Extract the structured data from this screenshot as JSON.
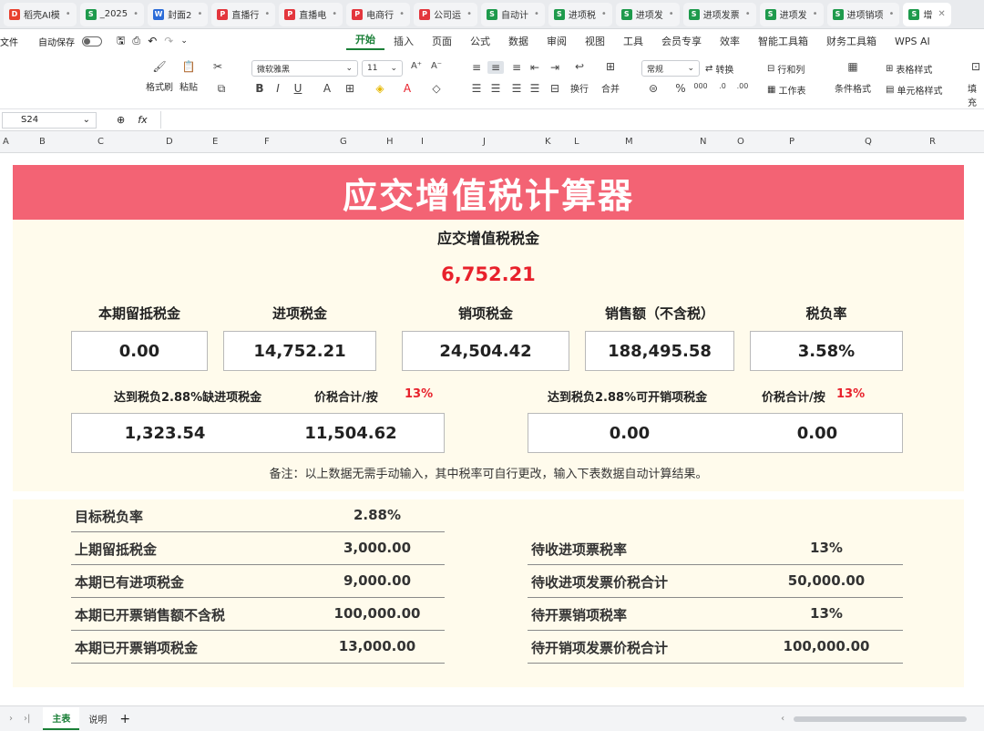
{
  "browser_tabs": [
    {
      "label": "稻壳AI模",
      "icon": "D",
      "color": "#e8412f"
    },
    {
      "label": "_2025",
      "icon": "S",
      "color": "#1e9a4c"
    },
    {
      "label": "封面2",
      "icon": "W",
      "color": "#2b6cd8"
    },
    {
      "label": "直播行",
      "icon": "P",
      "color": "#e3363d"
    },
    {
      "label": "直播电",
      "icon": "P",
      "color": "#e3363d"
    },
    {
      "label": "电商行",
      "icon": "P",
      "color": "#e3363d"
    },
    {
      "label": "公司运",
      "icon": "P",
      "color": "#e3363d"
    },
    {
      "label": "自动计",
      "icon": "S",
      "color": "#1e9a4c"
    },
    {
      "label": "进项税",
      "icon": "S",
      "color": "#1e9a4c"
    },
    {
      "label": "进项发",
      "icon": "S",
      "color": "#1e9a4c"
    },
    {
      "label": "进项发票",
      "icon": "S",
      "color": "#1e9a4c"
    },
    {
      "label": "进项发",
      "icon": "S",
      "color": "#1e9a4c"
    },
    {
      "label": "进项销项",
      "icon": "S",
      "color": "#1e9a4c"
    },
    {
      "label": "增",
      "icon": "S",
      "color": "#1e9a4c"
    }
  ],
  "menubar": {
    "file": "文件",
    "autosave": "自动保存",
    "items": [
      "开始",
      "插入",
      "页面",
      "公式",
      "数据",
      "审阅",
      "视图",
      "工具",
      "会员专享",
      "效率",
      "智能工具箱",
      "财务工具箱",
      "WPS AI"
    ]
  },
  "ribbon": {
    "format_painter": "格式刷",
    "paste": "粘贴",
    "font_name": "微软雅黑",
    "font_size": "11",
    "wrap": "换行",
    "merge": "合并",
    "number_format": "常规",
    "convert": "转换",
    "rows_cols": "行和列",
    "worksheet": "工作表",
    "cond_format": "条件格式",
    "table_style": "表格样式",
    "cell_style": "单元格样式",
    "fill": "填充"
  },
  "formula_bar": {
    "cell_ref": "S24",
    "fx": "fx"
  },
  "columns": [
    "A",
    "B",
    "C",
    "D",
    "E",
    "F",
    "G",
    "H",
    "I",
    "J",
    "K",
    "L",
    "M",
    "N",
    "O",
    "P",
    "Q",
    "R"
  ],
  "calculator": {
    "title": "应交增值税计算器",
    "payable_label": "应交增值税税金",
    "payable_value": "6,752.21",
    "metrics": [
      {
        "label": "本期留抵税金",
        "value": "0.00"
      },
      {
        "label": "进项税金",
        "value": "14,752.21"
      },
      {
        "label": "销项税金",
        "value": "24,504.42"
      },
      {
        "label": "销售额（不含税）",
        "value": "188,495.58"
      },
      {
        "label": "税负率",
        "value": "3.58%"
      }
    ],
    "left_block": {
      "label": "达到税负2.88%缺进项税金",
      "sub_label": "价税合计/按",
      "rate": "13%",
      "value1": "1,323.54",
      "value2": "11,504.62"
    },
    "right_block": {
      "label": "达到税负2.88%可开销项税金",
      "sub_label": "价税合计/按",
      "rate": "13%",
      "value1": "0.00",
      "value2": "0.00"
    },
    "note": "备注：以上数据无需手动输入，其中税率可自行更改，输入下表数据自动计算结果。"
  },
  "inputs": {
    "left": [
      {
        "label": "目标税负率",
        "value": "2.88%"
      },
      {
        "label": "上期留抵税金",
        "value": "3,000.00"
      },
      {
        "label": "本期已有进项税金",
        "value": "9,000.00"
      },
      {
        "label": "本期已开票销售额不含税",
        "value": "100,000.00"
      },
      {
        "label": "本期已开票销项税金",
        "value": "13,000.00"
      }
    ],
    "right": [
      {
        "label": "待收进项票税率",
        "value": "13%"
      },
      {
        "label": "待收进项发票价税合计",
        "value": "50,000.00"
      },
      {
        "label": "待开票销项税率",
        "value": "13%"
      },
      {
        "label": "待开销项发票价税合计",
        "value": "100,000.00"
      }
    ]
  },
  "sheet_tabs": [
    "主表",
    "说明"
  ],
  "colors": {
    "banner": "#f36374",
    "panel": "#fffbec",
    "accent_red": "#e8212b",
    "active_green": "#1a7f37"
  }
}
